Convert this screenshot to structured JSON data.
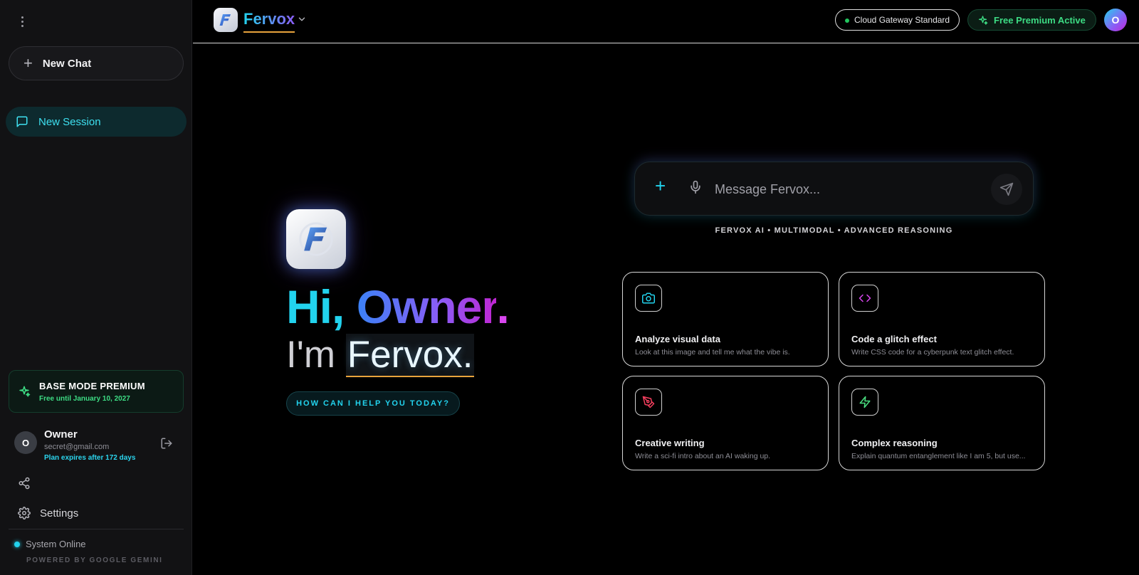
{
  "sidebar": {
    "new_chat_label": "New Chat",
    "session_label": "New Session",
    "premium": {
      "title": "BASE MODE PREMIUM",
      "subtitle": "Free until January 10, 2027"
    },
    "user": {
      "initial": "O",
      "name": "Owner",
      "email": "secret@gmail.com",
      "plan_note": "Plan expires after 172 days"
    },
    "settings_label": "Settings",
    "status_label": "System Online",
    "powered_by": "POWERED BY GOOGLE GEMINI"
  },
  "header": {
    "brand": "Fervox",
    "gateway_label": "Cloud Gateway Standard",
    "premium_label": "Free Premium Active",
    "avatar_initial": "O"
  },
  "hero": {
    "greeting_hi": "Hi,",
    "greeting_name": "Owner",
    "greeting_dot": ".",
    "im_prefix": "I'm",
    "im_name": "Fervox.",
    "help_label": "HOW CAN I HELP YOU TODAY?"
  },
  "composer": {
    "placeholder": "Message Fervox...",
    "tagline": "FERVOX AI • MULTIMODAL • ADVANCED REASONING"
  },
  "suggestions": [
    {
      "title": "Analyze visual data",
      "description": "Look at this image and tell me what the vibe is.",
      "icon": "camera-icon"
    },
    {
      "title": "Code a glitch effect",
      "description": "Write CSS code for a cyberpunk text glitch effect.",
      "icon": "code-icon"
    },
    {
      "title": "Creative writing",
      "description": "Write a sci-fi intro about an AI waking up.",
      "icon": "pen-tool-icon"
    },
    {
      "title": "Complex reasoning",
      "description": "Explain quantum entanglement like I am 5, but use...",
      "icon": "lightning-icon"
    }
  ],
  "colors": {
    "accent_cyan": "#22d3ee",
    "accent_purple": "#8b5cf6",
    "accent_magenta": "#d946ef",
    "success_green": "#3ddc84",
    "underline_orange": "#e8a33c"
  }
}
